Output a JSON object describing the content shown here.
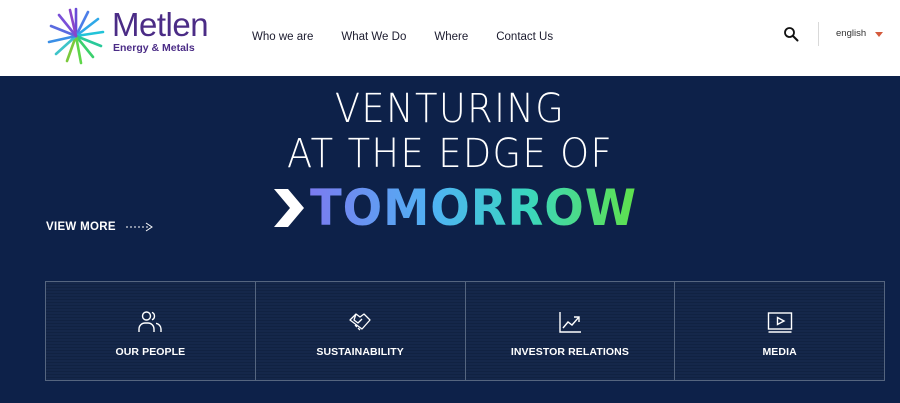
{
  "header": {
    "brand_name": "Metlen",
    "brand_sub": "Energy & Metals",
    "nav": [
      "Who we are",
      "What We Do",
      "Where",
      "Contact Us"
    ],
    "language": "english",
    "icons": {
      "search": "search-icon",
      "caret": "caret-down-icon",
      "logo": "starburst-logo"
    }
  },
  "hero": {
    "headline_line1": "VENTURING",
    "headline_line2": "AT THE EDGE OF",
    "headline_line3": "TOMORROW",
    "view_more": "VIEW MORE",
    "colors": {
      "background": "#0d2149",
      "gradient": [
        "#7b7bf0",
        "#4fb3f3",
        "#3ad6c0",
        "#5fe14a"
      ]
    }
  },
  "cards": [
    {
      "label": "OUR PEOPLE",
      "icon": "people-icon"
    },
    {
      "label": "SUSTAINABILITY",
      "icon": "handshake-icon"
    },
    {
      "label": "INVESTOR RELATIONS",
      "icon": "chart-icon"
    },
    {
      "label": "MEDIA",
      "icon": "play-icon"
    }
  ]
}
